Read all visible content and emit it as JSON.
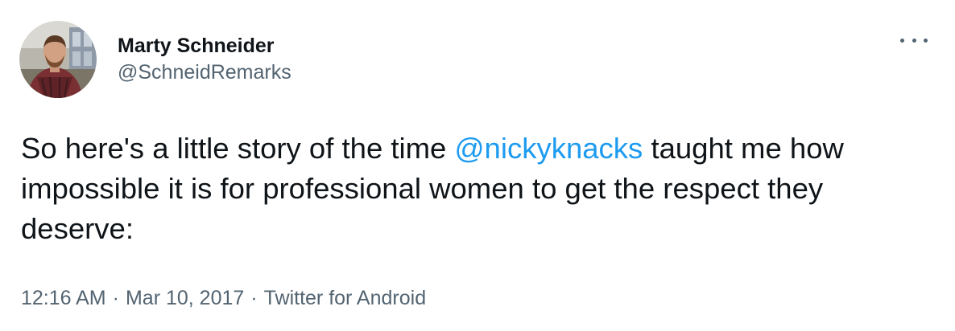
{
  "tweet": {
    "author": {
      "display_name": "Marty Schneider",
      "handle": "@SchneidRemarks",
      "avatar_icon": "profile-photo"
    },
    "text": {
      "part1": "So here's a little story of the time ",
      "mention": "@nickyknacks",
      "part2": " taught me how impossible it is for professional women to get the respect they deserve:"
    },
    "meta": {
      "time": "12:16 AM",
      "separator": "·",
      "date": "Mar 10, 2017",
      "source": "Twitter for Android"
    },
    "more_icon": "more-horizontal-icon"
  },
  "colors": {
    "text": "#0f1419",
    "secondary": "#536471",
    "link": "#1d9bf0"
  }
}
